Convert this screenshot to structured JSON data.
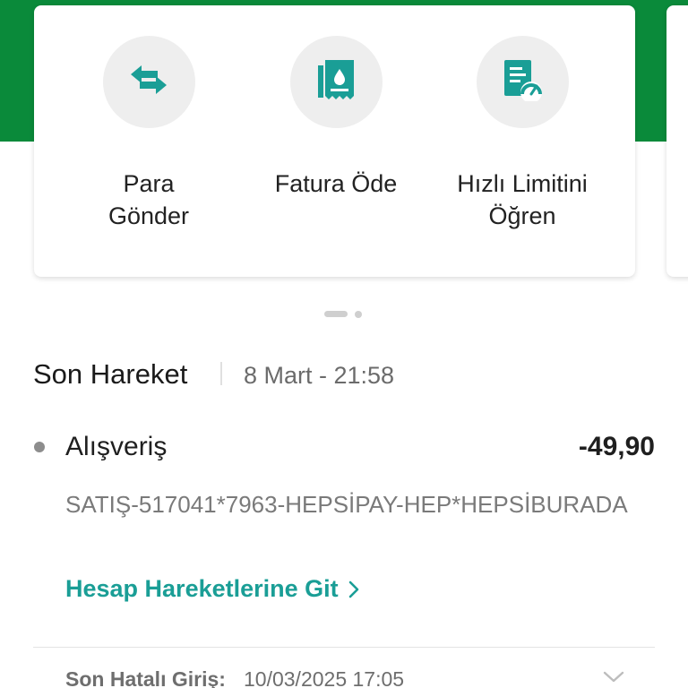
{
  "actions": [
    {
      "label": "Para\nGönder",
      "icon": "transfer-arrows-icon"
    },
    {
      "label": "Fatura Öde",
      "icon": "bill-receipt-icon"
    },
    {
      "label": "Hızlı Limitini\nÖğren",
      "icon": "limit-gauge-icon"
    }
  ],
  "last_transaction": {
    "section_title": "Son Hareket",
    "date": "8 Mart - 21:58",
    "title": "Alışveriş",
    "amount": "-49,90",
    "description": "SATIŞ-517041*7963-HEPSİPAY-HEP*HEPSİBURADA",
    "link_label": "Hesap Hareketlerine Git"
  },
  "failed_login": {
    "label": "Son Hatalı Giriş:",
    "value": "10/03/2025 17:05"
  },
  "colors": {
    "brand_green": "#0a8a3a",
    "accent_teal": "#1a9e96"
  }
}
